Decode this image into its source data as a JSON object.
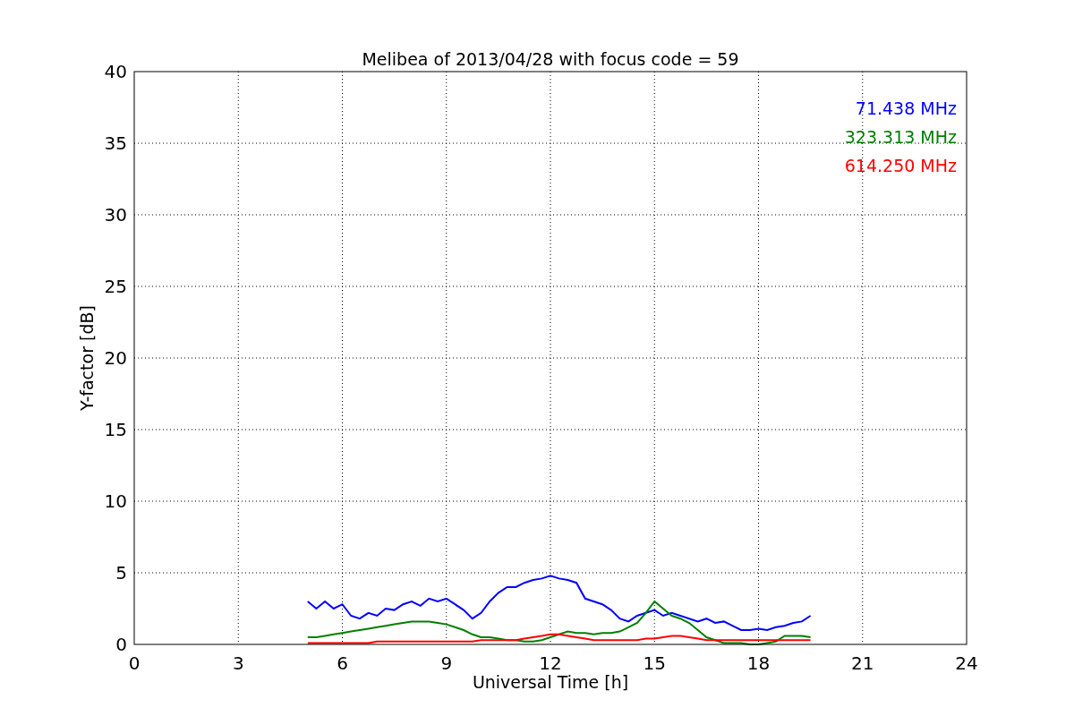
{
  "chart_data": {
    "type": "line",
    "title": "Melibea of 2013/04/28 with focus code = 59",
    "xlabel": "Universal Time [h]",
    "ylabel": "Y-factor [dB]",
    "x": [
      5,
      5.25,
      5.5,
      5.75,
      6,
      6.25,
      6.5,
      6.75,
      7,
      7.25,
      7.5,
      7.75,
      8,
      8.25,
      8.5,
      8.75,
      9,
      9.25,
      9.5,
      9.75,
      10,
      10.25,
      10.5,
      10.75,
      11,
      11.25,
      11.5,
      11.75,
      12,
      12.25,
      12.5,
      12.75,
      13,
      13.25,
      13.5,
      13.75,
      14,
      14.25,
      14.5,
      14.75,
      15,
      15.25,
      15.5,
      15.75,
      16,
      16.25,
      16.5,
      16.75,
      17,
      17.25,
      17.5,
      17.75,
      18,
      18.25,
      18.5,
      18.75,
      19,
      19.25,
      19.5
    ],
    "series": [
      {
        "name": "71.438 MHz",
        "color": "#0000ff",
        "values": [
          3,
          2.5,
          3,
          2.5,
          2.8,
          2,
          1.8,
          2.2,
          2,
          2.5,
          2.4,
          2.8,
          3,
          2.7,
          3.2,
          3,
          3.2,
          2.8,
          2.4,
          1.8,
          2.2,
          3,
          3.6,
          4,
          4,
          4.3,
          4.5,
          4.6,
          4.8,
          4.6,
          4.5,
          4.3,
          3.2,
          3,
          2.8,
          2.4,
          1.8,
          1.6,
          2,
          2.2,
          2.4,
          2,
          2.2,
          2,
          1.8,
          1.6,
          1.8,
          1.5,
          1.6,
          1.3,
          1,
          1,
          1.1,
          1,
          1.2,
          1.3,
          1.5,
          1.6,
          2
        ]
      },
      {
        "name": "323.313 MHz",
        "color": "#008000",
        "values": [
          0.5,
          0.5,
          0.6,
          0.7,
          0.8,
          0.9,
          1.0,
          1.1,
          1.2,
          1.3,
          1.4,
          1.5,
          1.6,
          1.6,
          1.6,
          1.5,
          1.4,
          1.2,
          1.0,
          0.7,
          0.5,
          0.5,
          0.4,
          0.3,
          0.3,
          0.2,
          0.2,
          0.3,
          0.5,
          0.7,
          0.9,
          0.8,
          0.8,
          0.7,
          0.8,
          0.8,
          0.9,
          1.2,
          1.5,
          2.2,
          3.0,
          2.5,
          2.0,
          1.8,
          1.5,
          1.0,
          0.5,
          0.3,
          0.1,
          0.1,
          0.1,
          0.0,
          0.0,
          0.1,
          0.2,
          0.6,
          0.6,
          0.6,
          0.5
        ]
      },
      {
        "name": "614.250 MHz",
        "color": "#ff0000",
        "values": [
          0.1,
          0.1,
          0.1,
          0.1,
          0.1,
          0.1,
          0.1,
          0.1,
          0.2,
          0.2,
          0.2,
          0.2,
          0.2,
          0.2,
          0.2,
          0.2,
          0.2,
          0.2,
          0.2,
          0.2,
          0.3,
          0.3,
          0.3,
          0.3,
          0.3,
          0.4,
          0.5,
          0.6,
          0.7,
          0.7,
          0.6,
          0.5,
          0.4,
          0.3,
          0.3,
          0.3,
          0.3,
          0.3,
          0.3,
          0.4,
          0.4,
          0.5,
          0.6,
          0.6,
          0.5,
          0.4,
          0.3,
          0.3,
          0.3,
          0.3,
          0.3,
          0.3,
          0.3,
          0.3,
          0.3,
          0.3,
          0.3,
          0.3,
          0.3
        ]
      }
    ],
    "grid": true,
    "xlim": [
      0,
      24
    ],
    "ylim": [
      0,
      40
    ],
    "xticks": [
      0,
      3,
      6,
      9,
      12,
      15,
      18,
      21,
      24
    ],
    "yticks": [
      0,
      5,
      10,
      15,
      20,
      25,
      30,
      35,
      40
    ]
  }
}
